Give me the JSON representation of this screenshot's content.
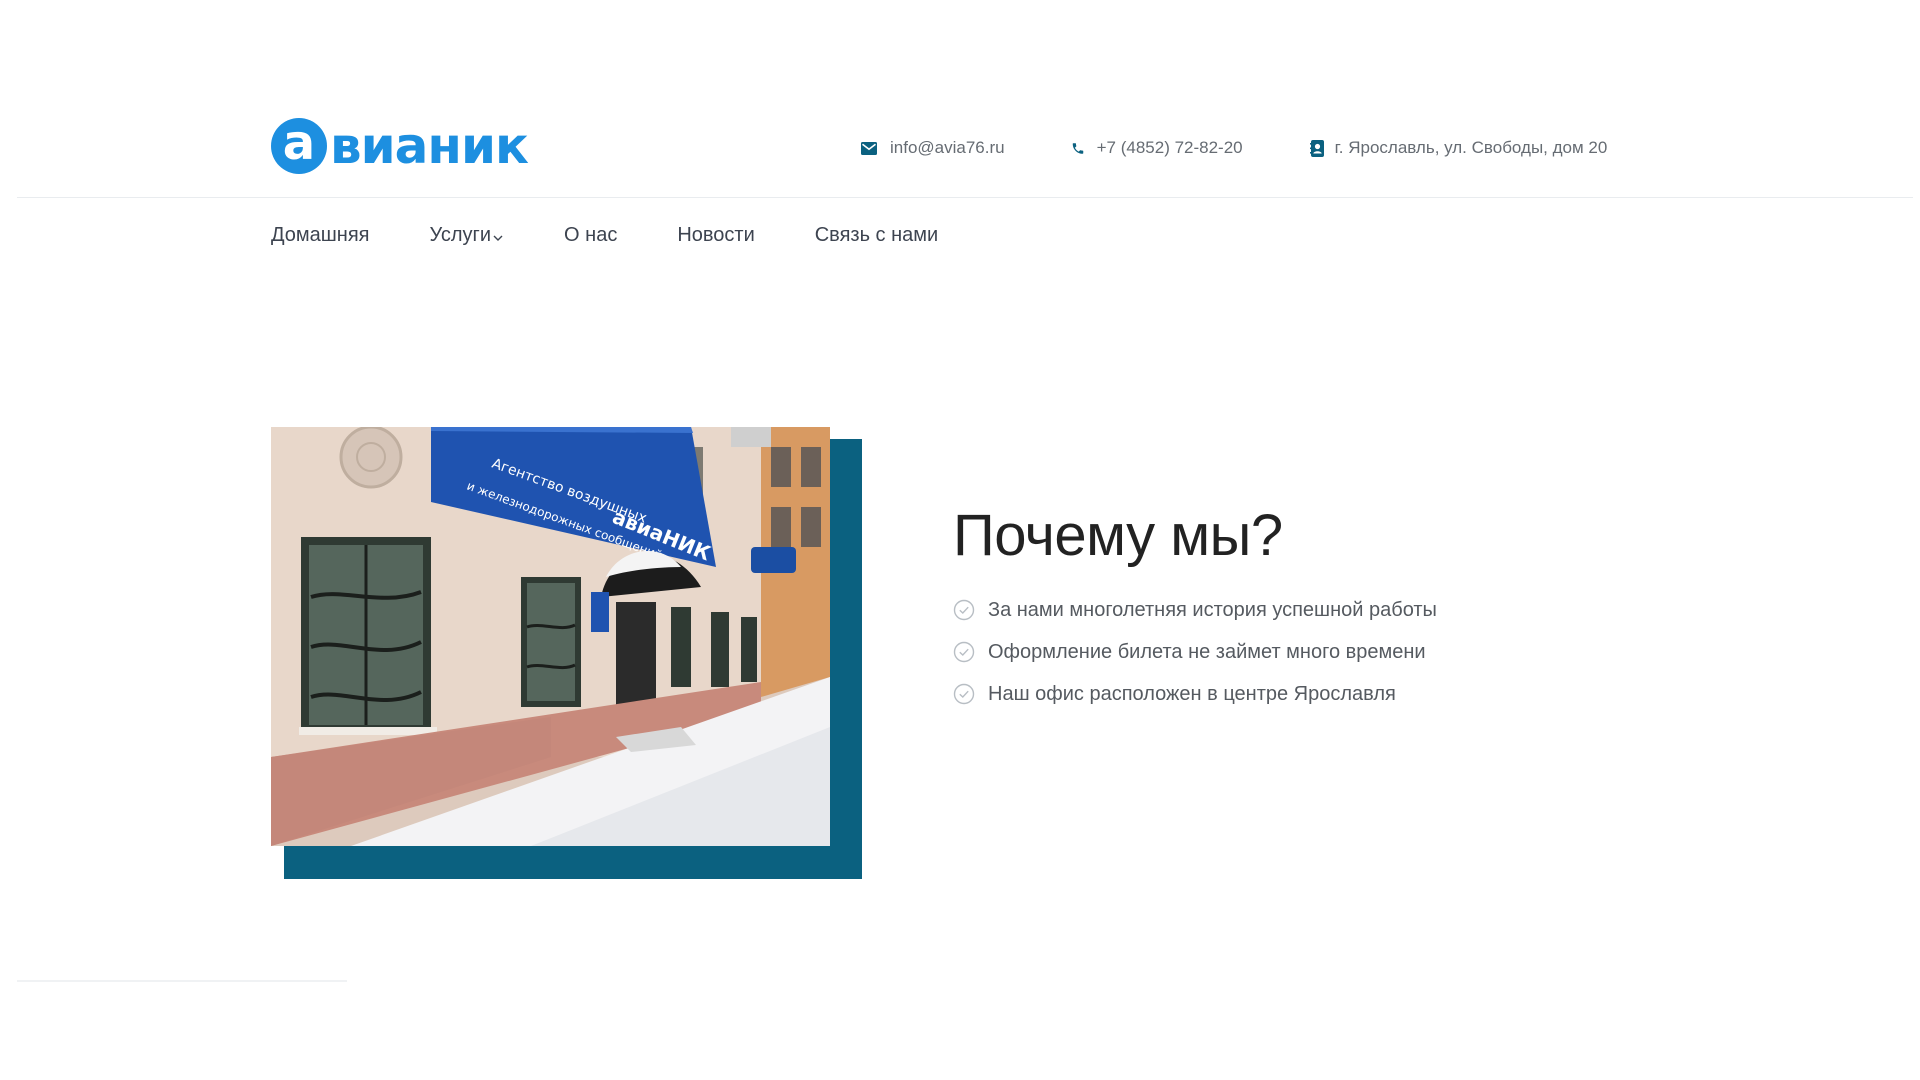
{
  "brand": {
    "logo_letter": "а",
    "logo_word": "вианик",
    "color": "#1d8fe0"
  },
  "contacts": {
    "email": {
      "icon": "envelope-icon",
      "text": "info@avia76.ru"
    },
    "phone": {
      "icon": "phone-icon",
      "text": "+7 (4852) 72-82-20"
    },
    "address": {
      "icon": "address-book-icon",
      "text": "г. Ярославль, ул. Свободы, дом 20"
    }
  },
  "nav": {
    "items": [
      {
        "label": "Домашняя"
      },
      {
        "label": "Услуги",
        "has_dropdown": true
      },
      {
        "label": "О нас"
      },
      {
        "label": "Новости"
      },
      {
        "label": "Связь с нами"
      }
    ]
  },
  "hero": {
    "title": "Почему мы?",
    "accent_color": "#0b6180",
    "features": [
      "За нами многолетняя история успешной работы",
      "Оформление билета не займет много времени",
      "Наш офис расположен в центре Ярославля"
    ],
    "photo": {
      "sign_line1": "Агентство воздушных",
      "sign_line2": "и железнодорожных сообщений",
      "sign_brand": "авиаНИК"
    }
  }
}
